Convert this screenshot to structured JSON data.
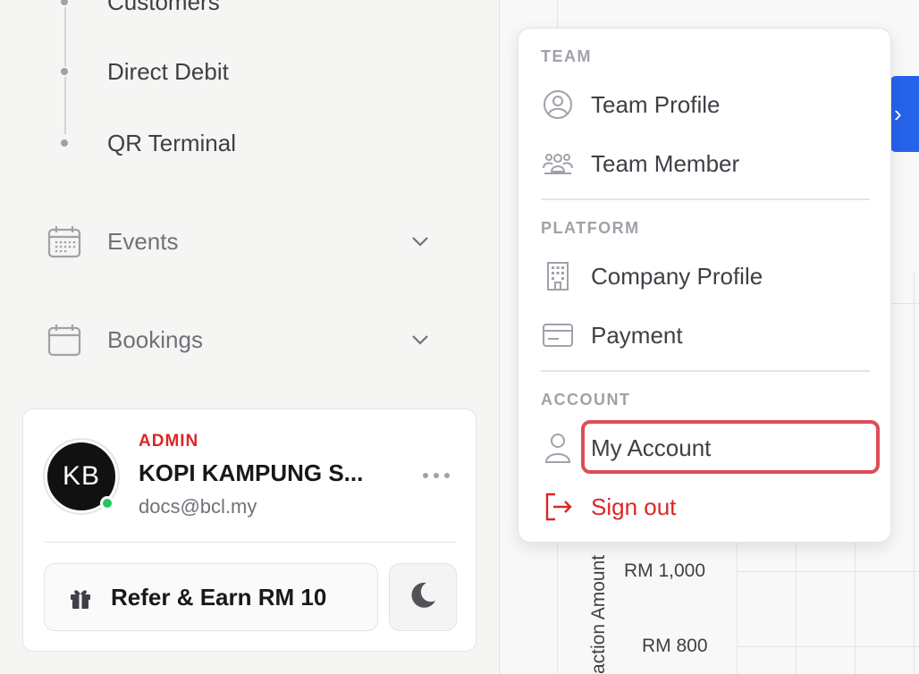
{
  "sidebar": {
    "sub_items": [
      {
        "label": "Customers"
      },
      {
        "label": "Direct Debit"
      },
      {
        "label": "QR Terminal"
      }
    ],
    "nav_items": [
      {
        "label": "Events",
        "icon": "calendar-grid-icon"
      },
      {
        "label": "Bookings",
        "icon": "calendar-icon"
      }
    ]
  },
  "profile": {
    "initials": "KB",
    "role": "ADMIN",
    "name": "KOPI KAMPUNG S...",
    "email": "docs@bcl.my",
    "status_color": "#22c55e",
    "refer_label": "Refer & Earn RM 10"
  },
  "dropdown": {
    "sections": [
      {
        "title": "TEAM",
        "items": [
          {
            "label": "Team Profile",
            "icon": "user-circle-icon"
          },
          {
            "label": "Team Member",
            "icon": "users-group-icon"
          }
        ]
      },
      {
        "title": "PLATFORM",
        "items": [
          {
            "label": "Company Profile",
            "icon": "building-icon"
          },
          {
            "label": "Payment",
            "icon": "credit-card-icon"
          }
        ]
      },
      {
        "title": "ACCOUNT",
        "items": [
          {
            "label": "My Account",
            "icon": "user-icon"
          },
          {
            "label": "Sign out",
            "icon": "sign-out-icon"
          }
        ]
      }
    ],
    "highlight_color": "#dc4c57"
  },
  "chart_bg": {
    "y_ticks": [
      "RM 1,000",
      "RM 800"
    ],
    "y_label": "action Amount"
  },
  "colors": {
    "accent_blue": "#2563eb",
    "danger": "#dc2626"
  }
}
